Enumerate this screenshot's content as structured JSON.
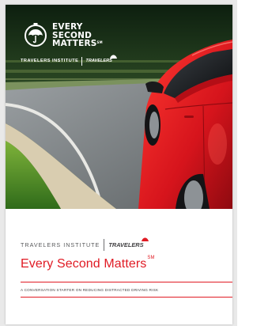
{
  "hero": {
    "logo": {
      "line1": "EVERY",
      "line2": "SECOND",
      "line3": "MATTERS",
      "mark": "SM"
    },
    "brand": {
      "institute": "TRAVELERS INSTITUTE",
      "company": "TRAVELERS"
    }
  },
  "footer": {
    "brand": {
      "institute": "TRAVELERS INSTITUTE",
      "company": "TRAVELERS"
    },
    "title": "Every Second Matters",
    "title_mark": "SM",
    "subtitle": "A CONVERSATION STARTER ON REDUCING DISTRACTED DRIVING RISK"
  },
  "colors": {
    "accent_red": "#e01b24",
    "car_red": "#d6141c",
    "text_gray": "#58595b"
  },
  "icons": [
    "stopwatch-umbrella-icon",
    "umbrella-icon"
  ]
}
